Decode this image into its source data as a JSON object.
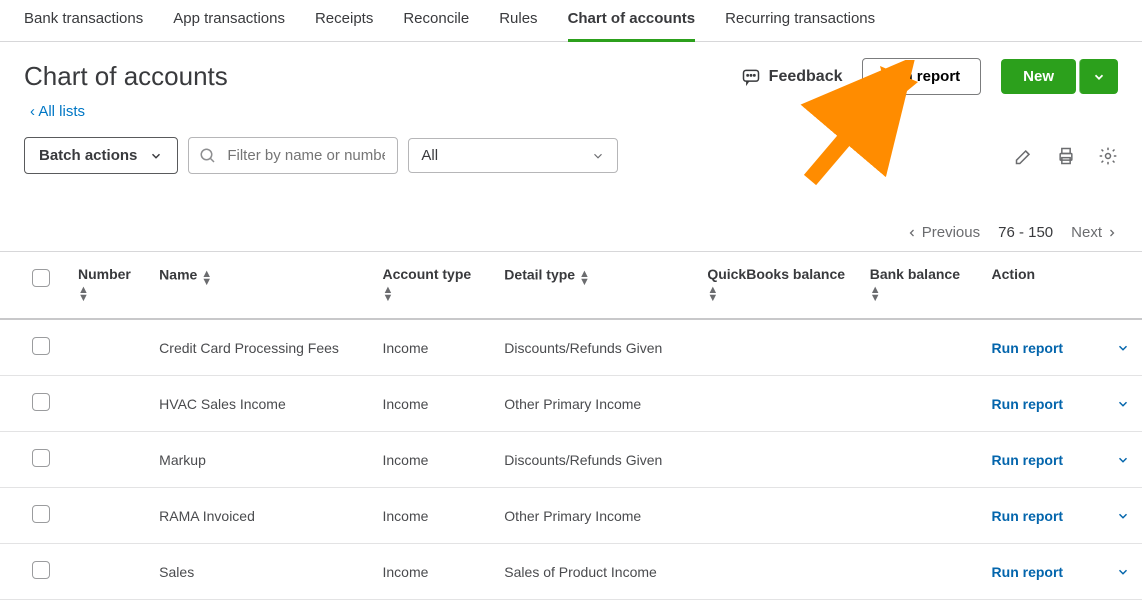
{
  "nav": {
    "tabs": [
      {
        "label": "Bank transactions",
        "active": false
      },
      {
        "label": "App transactions",
        "active": false
      },
      {
        "label": "Receipts",
        "active": false
      },
      {
        "label": "Reconcile",
        "active": false
      },
      {
        "label": "Rules",
        "active": false
      },
      {
        "label": "Chart of accounts",
        "active": true
      },
      {
        "label": "Recurring transactions",
        "active": false
      }
    ]
  },
  "header": {
    "title": "Chart of accounts",
    "feedback_label": "Feedback",
    "run_report_label": "Run report",
    "new_label": "New"
  },
  "back_link": {
    "label": "All lists",
    "chevron": "‹"
  },
  "filters": {
    "batch_label": "Batch actions",
    "search_placeholder": "Filter by name or number",
    "type_filter": "All"
  },
  "pagination": {
    "previous": "Previous",
    "range": "76 - 150",
    "next": "Next"
  },
  "table": {
    "columns": {
      "number": "Number",
      "name": "Name",
      "account_type": "Account type",
      "detail_type": "Detail type",
      "qb_balance": "QuickBooks balance",
      "bank_balance": "Bank balance",
      "action": "Action"
    },
    "row_action_label": "Run report",
    "rows": [
      {
        "number": "",
        "name": "Credit Card Processing Fees",
        "account_type": "Income",
        "detail_type": "Discounts/Refunds Given",
        "qb_balance": "",
        "bank_balance": ""
      },
      {
        "number": "",
        "name": "HVAC Sales Income",
        "account_type": "Income",
        "detail_type": "Other Primary Income",
        "qb_balance": "",
        "bank_balance": ""
      },
      {
        "number": "",
        "name": "Markup",
        "account_type": "Income",
        "detail_type": "Discounts/Refunds Given",
        "qb_balance": "",
        "bank_balance": ""
      },
      {
        "number": "",
        "name": "RAMA Invoiced",
        "account_type": "Income",
        "detail_type": "Other Primary Income",
        "qb_balance": "",
        "bank_balance": ""
      },
      {
        "number": "",
        "name": "Sales",
        "account_type": "Income",
        "detail_type": "Sales of Product Income",
        "qb_balance": "",
        "bank_balance": ""
      }
    ]
  },
  "colors": {
    "primary_green": "#2ca01c",
    "link_blue": "#0077c5",
    "arrow_orange": "#ff8c00"
  }
}
